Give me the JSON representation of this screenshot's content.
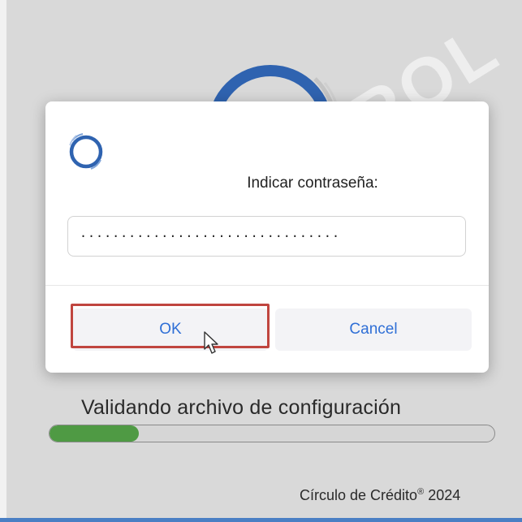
{
  "dialog": {
    "prompt": "Indicar contraseña:",
    "password_value": "································",
    "ok_label": "OK",
    "cancel_label": "Cancel"
  },
  "status": {
    "message": "Validando archivo de configuración",
    "progress_fraction": 0.2
  },
  "footer": {
    "brand": "Círculo de Crédito",
    "trademark": "®",
    "year": "2024"
  },
  "watermark": {
    "text": "JO CONTROL"
  },
  "icons": [
    "circulo-logo-icon",
    "mouse-pointer-icon"
  ],
  "colors": {
    "accent": "#2f6fd6",
    "progress": "#4f9a44",
    "highlight": "#c0453f",
    "logo": "#2f63b0"
  }
}
